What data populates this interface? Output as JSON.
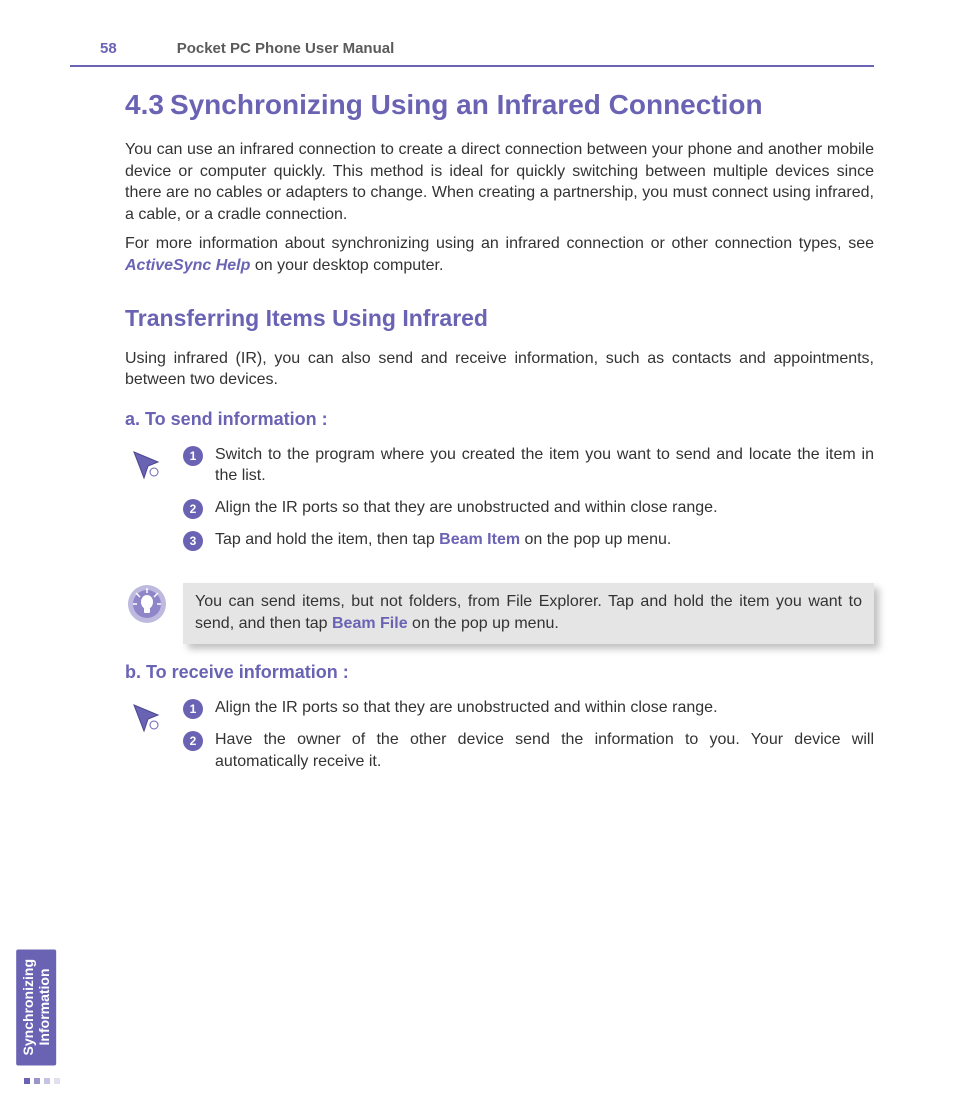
{
  "header": {
    "page_number": "58",
    "doc_title": "Pocket PC Phone User Manual"
  },
  "section": {
    "number": "4.3",
    "title": "Synchronizing Using an Infrared Connection"
  },
  "intro_para_1": "You can use an infrared connection to create a direct  connection between your phone and another mobile device or computer quickly. This method is ideal for quickly switching between multiple devices since there are no cables or adapters to change. When creating a partnership, you must connect using infrared, a cable, or a cradle connection.",
  "intro_para_2_pre": "For more information about synchronizing using an infrared connection or other connection types, see ",
  "intro_para_2_link": "ActiveSync Help",
  "intro_para_2_post": " on your desktop computer.",
  "subhead": "Transferring Items Using Infrared",
  "sub_para": "Using infrared (IR), you can also send and receive information, such as contacts and appointments, between two devices.",
  "send": {
    "heading": "a. To send information :",
    "steps": [
      {
        "n": "1",
        "text": "Switch to the program where you created the item you want to send and locate the item in the list."
      },
      {
        "n": "2",
        "text": "Align the IR ports so that they are unobstructed and within close range."
      },
      {
        "n": "3",
        "pre": "Tap and hold the item, then tap ",
        "bold": "Beam Item",
        "post": " on the pop up menu."
      }
    ]
  },
  "tip": {
    "pre": "You can send items, but not folders, from File Explorer. Tap and hold the item you want to send, and then tap ",
    "bold": "Beam File",
    "post": " on the pop up menu."
  },
  "receive": {
    "heading": "b. To receive information :",
    "steps": [
      {
        "n": "1",
        "text": "Align the IR ports so that they are unobstructed and within close range."
      },
      {
        "n": "2",
        "text": "Have the owner of the other device send the information to you. Your device will automatically receive it."
      }
    ]
  },
  "side_tab_line1": "Synchronizing",
  "side_tab_line2": "Information"
}
